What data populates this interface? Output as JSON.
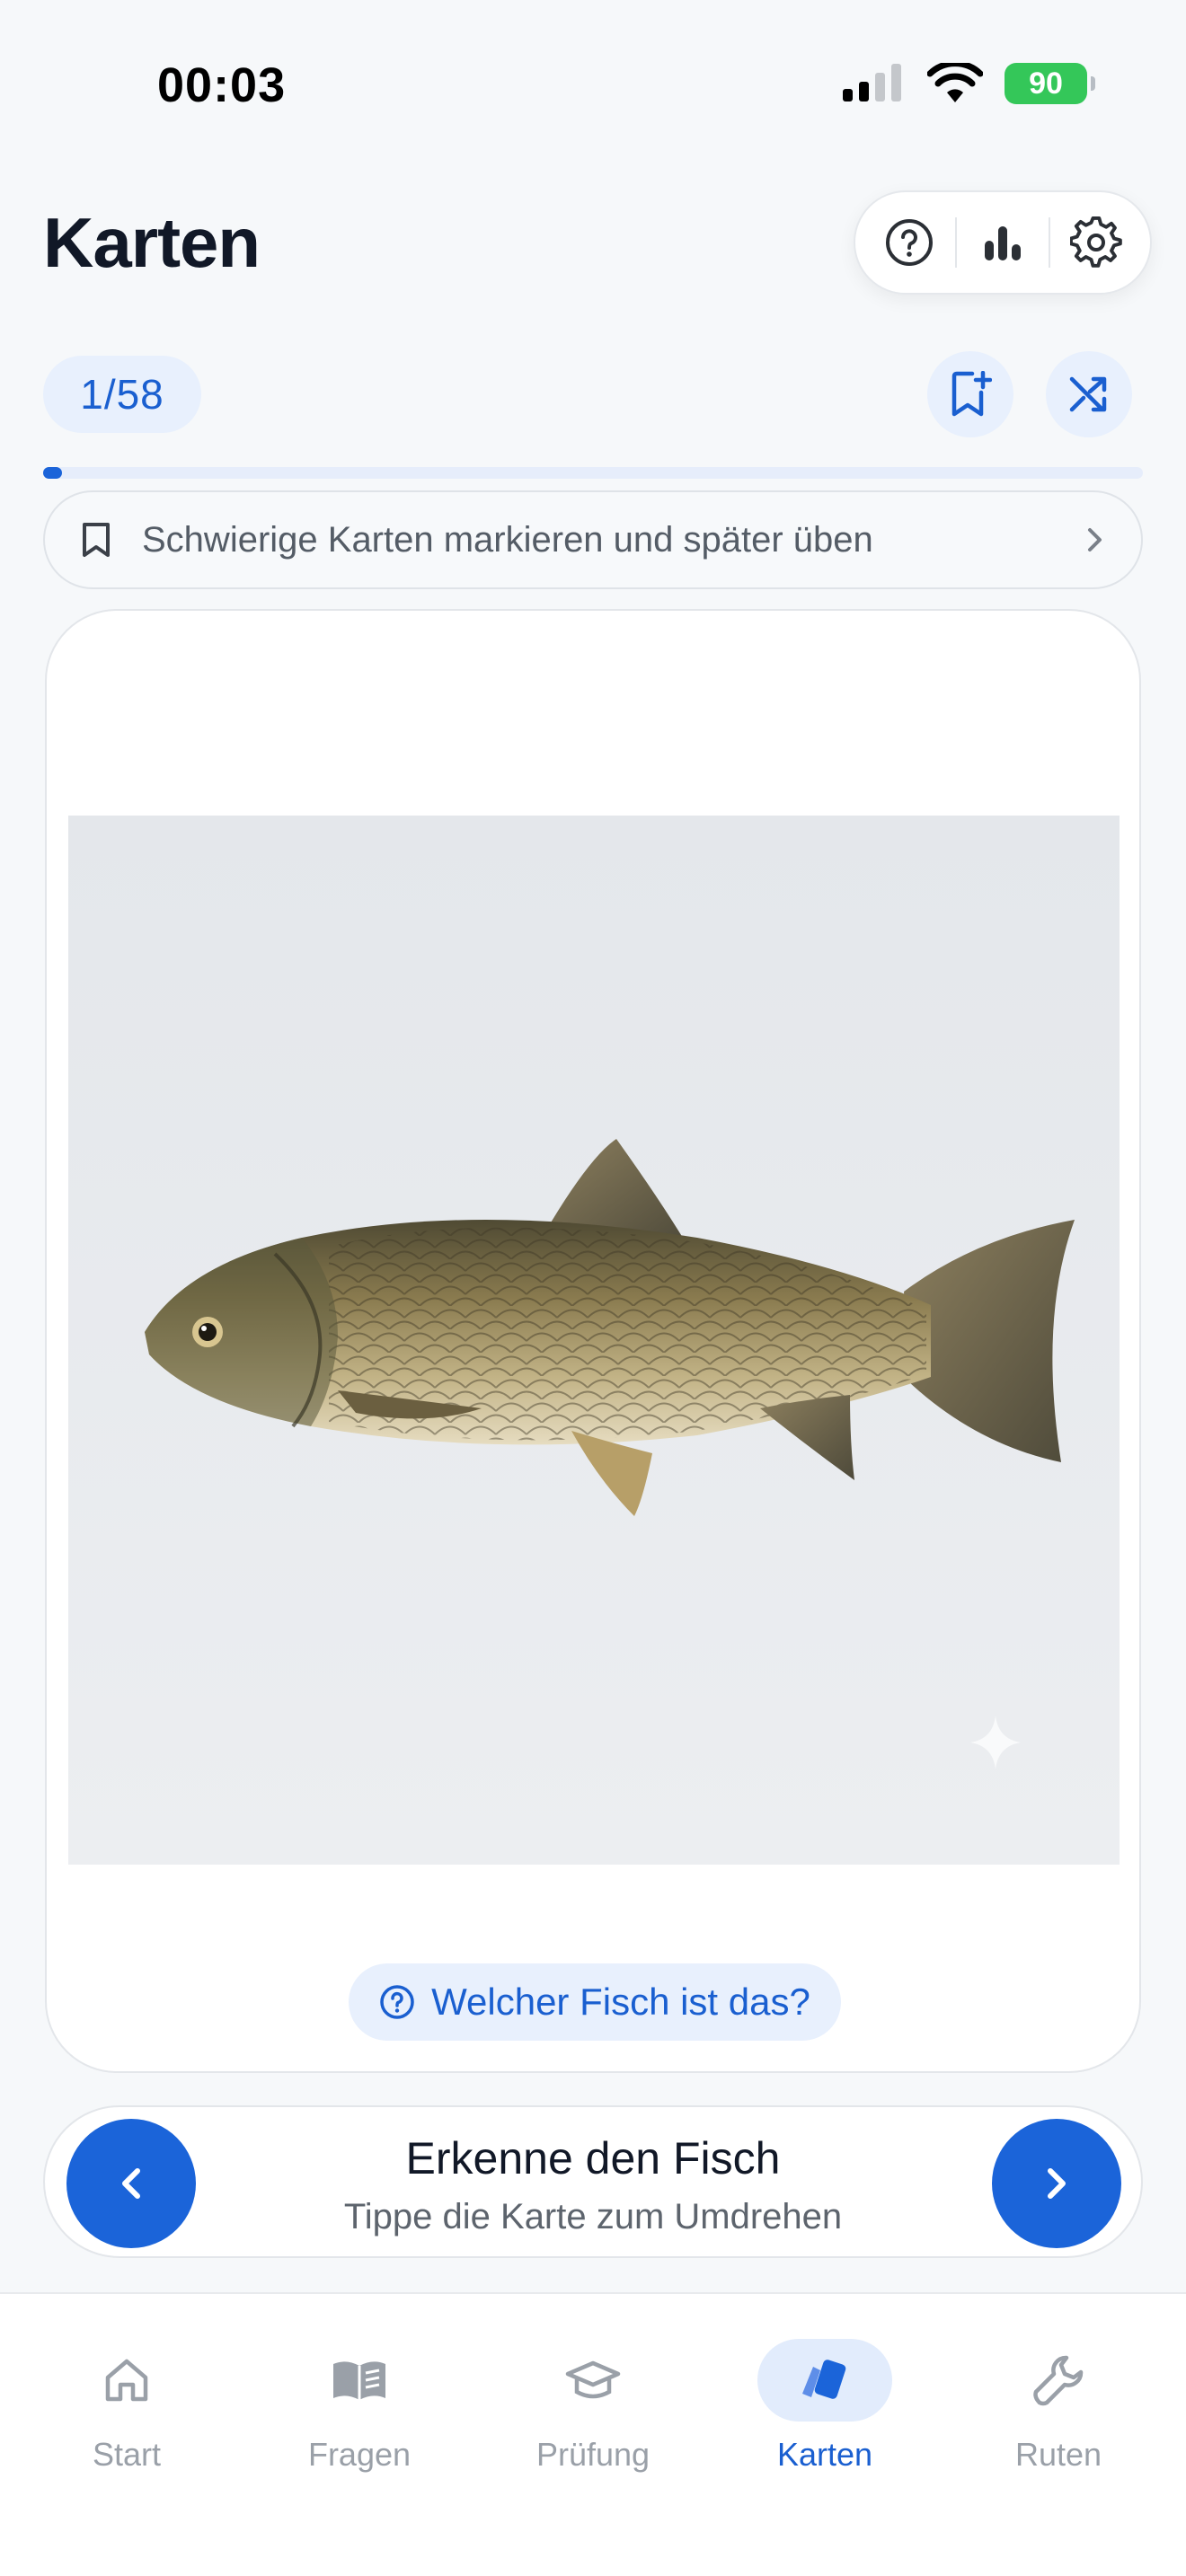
{
  "status_bar": {
    "time": "00:03",
    "battery": "90"
  },
  "header": {
    "title": "Karten",
    "actions": [
      "help-icon",
      "stats-icon",
      "settings-icon"
    ]
  },
  "toolbar": {
    "counter": "1/58",
    "progress": 0.0172,
    "bookmark_icon": "bookmark-add-icon",
    "shuffle_icon": "shuffle-icon"
  },
  "hint": {
    "text": "Schwierige Karten markieren und später üben"
  },
  "card": {
    "question": "Welcher Fisch ist das?"
  },
  "navigation": {
    "title": "Erkenne den Fisch",
    "subtitle": "Tippe die Karte zum Umdrehen"
  },
  "tabs": [
    {
      "label": "Start",
      "icon": "home-icon",
      "active": false
    },
    {
      "label": "Fragen",
      "icon": "book-icon",
      "active": false
    },
    {
      "label": "Prüfung",
      "icon": "graduation-cap-icon",
      "active": false
    },
    {
      "label": "Karten",
      "icon": "cards-icon",
      "active": true
    },
    {
      "label": "Ruten",
      "icon": "wrench-icon",
      "active": false
    }
  ],
  "colors": {
    "accent": "#1b64d9",
    "accent_light": "#e8f0fd",
    "battery": "#34c759"
  }
}
